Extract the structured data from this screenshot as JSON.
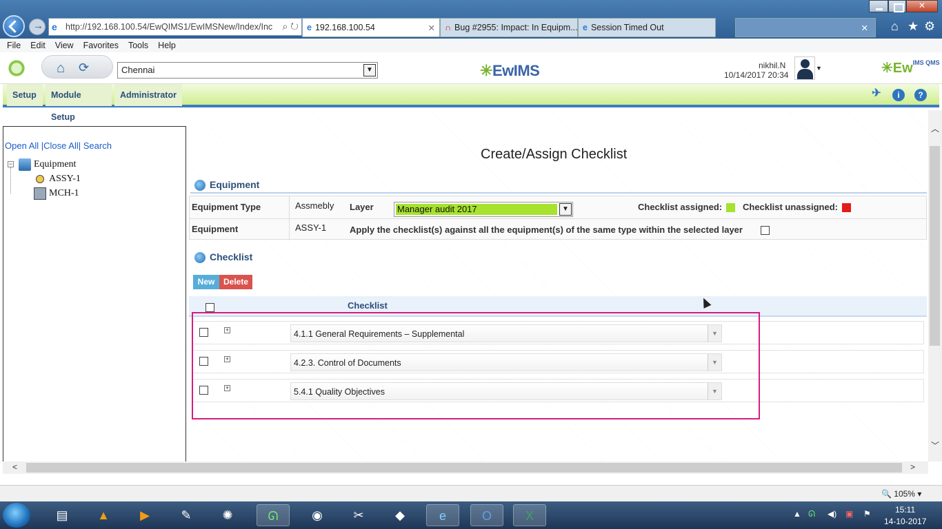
{
  "browser": {
    "address": "http://192.168.100.54/EwQIMS1/EwIMSNew/Index/Inc",
    "tabs": [
      {
        "label": "192.168.100.54",
        "close": "✕"
      },
      {
        "label": "Bug #2955: Impact: In Equipm..."
      },
      {
        "label": "Session Timed Out"
      },
      {
        "label": "",
        "close": "✕"
      }
    ]
  },
  "menu": [
    "File",
    "Edit",
    "View",
    "Favorites",
    "Tools",
    "Help"
  ],
  "header": {
    "site": "Chennai",
    "brand": "EwIMS",
    "user": "nikhil.N",
    "datetime": "10/14/2017 20:34",
    "brand2": "Ew",
    "brand2_sub": "IMS QMS"
  },
  "nav": {
    "setup": "Setup",
    "module_setup": "Module Setup",
    "administrator": "Administrator"
  },
  "tree": {
    "open_all": "Open All",
    "close_all": "Close All",
    "search": "Search",
    "root": "Equipment",
    "children": [
      "ASSY-1",
      "MCH-1"
    ]
  },
  "page": {
    "title": "Create/Assign Checklist",
    "equipment_section": "Equipment",
    "equipment_type_label": "Equipment Type",
    "equipment_type_value": "Assmebly",
    "layer_label": "Layer",
    "layer_value": "Manager audit 2017",
    "checklist_assigned": "Checklist assigned:",
    "checklist_unassigned": "Checklist unassigned:",
    "equipment_label": "Equipment",
    "equipment_value": "ASSY-1",
    "apply_text": "Apply the checklist(s) against all the equipment(s) of the same type within the selected layer",
    "checklist_section": "Checklist",
    "new_button": "New",
    "delete_button": "Delete",
    "grid_header": "Checklist",
    "rows": [
      "4.1.1 General Requirements – Supplemental",
      "4.2.3. Control of Documents",
      "5.4.1 Quality Objectives"
    ]
  },
  "colors": {
    "assigned": "#a6e22e",
    "unassigned": "#e31b1b",
    "highlight": "#d81b7f"
  },
  "status": {
    "zoom": "105%"
  },
  "clock": {
    "time": "15:11",
    "date": "14-10-2017"
  }
}
